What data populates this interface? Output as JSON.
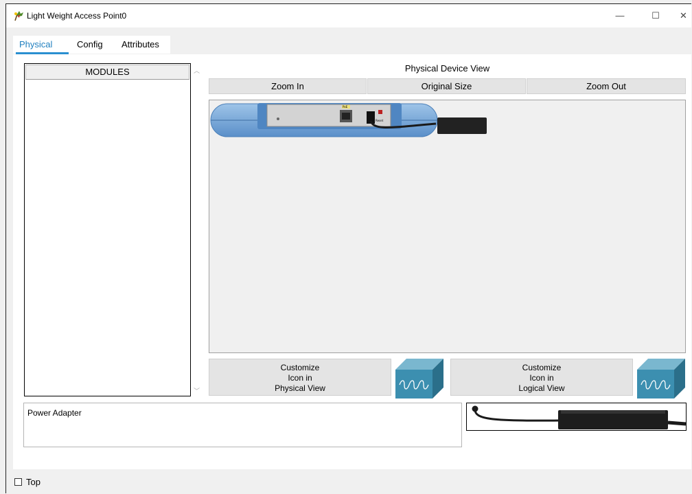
{
  "window": {
    "title": "Light Weight Access Point0",
    "minimize_glyph": "—",
    "maximize_glyph": "☐",
    "close_glyph": "✕"
  },
  "tabs": [
    {
      "label": "Physical",
      "active": true
    },
    {
      "label": "Config",
      "active": false
    },
    {
      "label": "Attributes",
      "active": false
    }
  ],
  "modules": {
    "header": "MODULES",
    "items": []
  },
  "device_view": {
    "title": "Physical Device View",
    "zoom_in": "Zoom In",
    "original_size": "Original Size",
    "zoom_out": "Zoom Out",
    "port_labels": {
      "poe": "PoE",
      "reset": "Reset"
    }
  },
  "customize": {
    "physical_lines": [
      "Customize",
      "Icon in",
      "Physical View"
    ],
    "logical_lines": [
      "Customize",
      "Icon in",
      "Logical View"
    ]
  },
  "description": {
    "text": "Power Adapter"
  },
  "bottom": {
    "top_label": "Top",
    "top_checked": false
  },
  "colors": {
    "accent": "#2a8fd0",
    "device_blue": "#6ea3d6",
    "ap_icon": "#3c8fb0"
  },
  "icons": {
    "app": "access-point-app-icon",
    "ap_physical": "access-point-icon",
    "ap_logical": "access-point-icon"
  }
}
